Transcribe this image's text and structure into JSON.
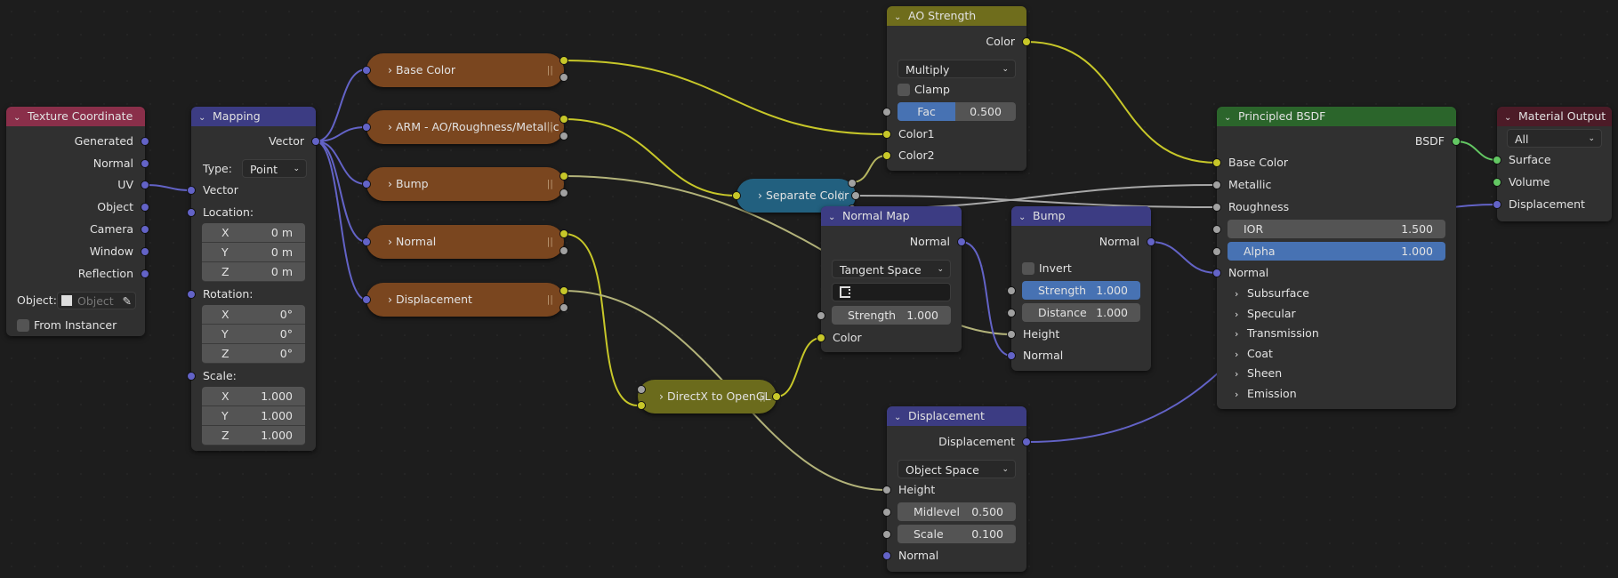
{
  "colors": {
    "socket_vector": "#6363c7",
    "socket_color": "#c7c729",
    "socket_float": "#a1a1a1",
    "socket_shader": "#63c763",
    "selected_field": "#4772b3"
  },
  "texture_coordinate": {
    "title": "Texture Coordinate",
    "outputs": [
      "Generated",
      "Normal",
      "UV",
      "Object",
      "Camera",
      "Window",
      "Reflection"
    ],
    "object_label": "Object:",
    "object_placeholder": "Object",
    "from_instancer": "From Instancer"
  },
  "mapping": {
    "title": "Mapping",
    "output": "Vector",
    "type_label": "Type:",
    "type_value": "Point",
    "vector_in": "Vector",
    "location_label": "Location:",
    "location": [
      {
        "axis": "X",
        "value": "0 m"
      },
      {
        "axis": "Y",
        "value": "0 m"
      },
      {
        "axis": "Z",
        "value": "0 m"
      }
    ],
    "rotation_label": "Rotation:",
    "rotation": [
      {
        "axis": "X",
        "value": "0°"
      },
      {
        "axis": "Y",
        "value": "0°"
      },
      {
        "axis": "Z",
        "value": "0°"
      }
    ],
    "scale_label": "Scale:",
    "scale": [
      {
        "axis": "X",
        "value": "1.000"
      },
      {
        "axis": "Y",
        "value": "1.000"
      },
      {
        "axis": "Z",
        "value": "1.000"
      }
    ]
  },
  "groups": [
    "Base Color",
    "ARM - AO/Roughness/Metallic",
    "Bump",
    "Normal",
    "Displacement"
  ],
  "separate_color": {
    "title": "Separate Color"
  },
  "directx": {
    "title": "DirectX to OpenGL"
  },
  "ao_strength": {
    "title": "AO Strength",
    "output": "Color",
    "blend": "Multiply",
    "clamp": "Clamp",
    "fac_label": "Fac",
    "fac_value": "0.500",
    "color1": "Color1",
    "color2": "Color2"
  },
  "normal_map": {
    "title": "Normal Map",
    "output": "Normal",
    "space": "Tangent Space",
    "strength_label": "Strength",
    "strength_value": "1.000",
    "color": "Color"
  },
  "bump": {
    "title": "Bump",
    "output": "Normal",
    "invert": "Invert",
    "strength_label": "Strength",
    "strength_value": "1.000",
    "distance_label": "Distance",
    "distance_value": "1.000",
    "height": "Height",
    "normal": "Normal"
  },
  "displacement": {
    "title": "Displacement",
    "output": "Displacement",
    "space": "Object Space",
    "height": "Height",
    "midlevel_label": "Midlevel",
    "midlevel_value": "0.500",
    "scale_label": "Scale",
    "scale_value": "0.100",
    "normal": "Normal"
  },
  "principled": {
    "title": "Principled BSDF",
    "output": "BSDF",
    "base_color": "Base Color",
    "metallic": "Metallic",
    "roughness": "Roughness",
    "ior_label": "IOR",
    "ior_value": "1.500",
    "alpha_label": "Alpha",
    "alpha_value": "1.000",
    "normal": "Normal",
    "panels": [
      "Subsurface",
      "Specular",
      "Transmission",
      "Coat",
      "Sheen",
      "Emission"
    ]
  },
  "material_output": {
    "title": "Material Output",
    "target": "All",
    "surface": "Surface",
    "volume": "Volume",
    "displacement": "Displacement"
  }
}
